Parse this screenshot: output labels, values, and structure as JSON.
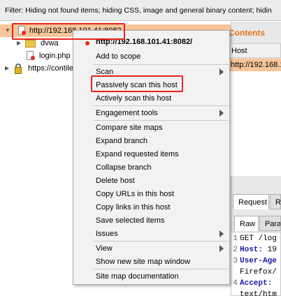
{
  "filter": {
    "text": "Filter: Hiding not found items;  hiding CSS, image and general binary content;  hidin"
  },
  "tree": {
    "root": "http://192.168.101.41:8082",
    "folder": "dvwa",
    "file": "login.php",
    "other_host": "https://contile"
  },
  "menu": {
    "header": "http://192.168.101.41:8082/",
    "items": {
      "add_to_scope": "Add to scope",
      "scan": "Scan",
      "passive_scan": "Passively scan this host",
      "active_scan": "Actively scan this host",
      "engagement_tools": "Engagement tools",
      "compare": "Compare site maps",
      "expand_branch": "Expand branch",
      "expand_requested": "Expand requested items",
      "collapse_branch": "Collapse branch",
      "delete_host": "Delete host",
      "copy_urls": "Copy URLs in this host",
      "copy_links": "Copy links in this host",
      "save_items": "Save selected items",
      "issues": "Issues",
      "view": "View",
      "new_window": "Show new site map window",
      "documentation": "Site map documentation"
    }
  },
  "contents": {
    "title": "Contents",
    "column_host": "Host",
    "row_host": "http://192.168.1"
  },
  "request": {
    "tab_request": "Request",
    "tab_r": "R",
    "tab_raw": "Raw",
    "tab_params": "Param",
    "lines": [
      {
        "n": "1",
        "text": "GET /log"
      },
      {
        "n": "2",
        "key": "Host:",
        "text": " 19"
      },
      {
        "n": "3",
        "key": "User-Age",
        "text": ""
      },
      {
        "n": "",
        "text": "Firefox/"
      },
      {
        "n": "4",
        "key": "Accept:",
        "text": ""
      },
      {
        "n": "",
        "text": "text/htm"
      }
    ]
  },
  "colors": {
    "selection": "#f6c59a",
    "highlight": "#e8241c",
    "accent": "#e8731c"
  }
}
